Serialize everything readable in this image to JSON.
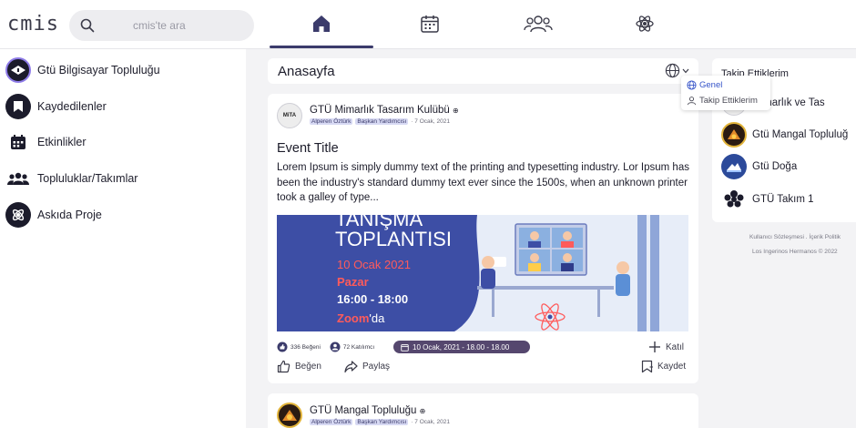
{
  "app": {
    "logo": "cmis"
  },
  "search": {
    "placeholder": "cmis'te ara"
  },
  "nav": {
    "tabs": [
      "home-icon",
      "calendar-icon",
      "people-icon",
      "atom-icon"
    ],
    "active": "home-icon"
  },
  "sidebar": {
    "items": [
      {
        "label": "Gtü Bilgisayar Topluluğu",
        "icon": "club-logo-icon"
      },
      {
        "label": "Kaydedilenler",
        "icon": "bookmark-icon"
      },
      {
        "label": "Etkinlikler",
        "icon": "calendar-icon"
      },
      {
        "label": "Topluluklar/Takımlar",
        "icon": "group-icon"
      },
      {
        "label": "Askıda Proje",
        "icon": "project-icon"
      }
    ]
  },
  "feed": {
    "title": "Anasayfa",
    "filter_menu": {
      "items": [
        "Genel",
        "Takip Ettiklerim"
      ],
      "active": "Genel"
    }
  },
  "post": {
    "club": "GTÜ Mimarlık Tasarım Kulübü",
    "author_tag": "Alperen Öztürk",
    "role_tag": "Başkan Yardımcısı",
    "date": "· 7 Ocak, 2021",
    "avatar_text": "MiTA",
    "title": "Event Title",
    "body": "Lorem Ipsum is simply dummy text of the printing and typesetting industry. Lor Ipsum has been the industry's standard dummy text ever since the 1500s, when an unknown printer took a galley of type...",
    "poster": {
      "line1": "TANIŞMA",
      "line2": "TOPLANTISI",
      "date": "10 Ocak 2021",
      "day": "Pazar",
      "time": "16:00 - 18:00",
      "platform_highlight": "Zoom",
      "platform_suffix": "'da"
    },
    "likes": "336 Beğeni",
    "participants": "72 Katılımcı",
    "event_time": "10 Ocak, 2021 - 18.00 - 18.00",
    "join_label": "Katıl",
    "like_label": "Beğen",
    "share_label": "Paylaş",
    "save_label": "Kaydet"
  },
  "post2": {
    "club": "GTÜ Mangal Topluluğu",
    "author_tag": "Alperen Öztürk",
    "role_tag": "Başkan Yardımcısı",
    "date": "· 7 Ocak, 2021"
  },
  "following": {
    "title": "Takip Ettiklerim",
    "items": [
      {
        "label": "Mimarlık ve Tas"
      },
      {
        "label": "Gtü Mangal Topluluğ"
      },
      {
        "label": "Gtü Doğa"
      },
      {
        "label": "GTÜ Takım 1"
      }
    ]
  },
  "footer": {
    "links": "Kullanıcı Sözleşmesi . İçerik Politik",
    "copyright": "Los Ingerinos Hermanos © 2022"
  },
  "colors": {
    "accent": "#3b3b6b",
    "poster_bg": "#3d4ea5",
    "poster_red": "#ff5b5b",
    "pill": "#55476e"
  }
}
